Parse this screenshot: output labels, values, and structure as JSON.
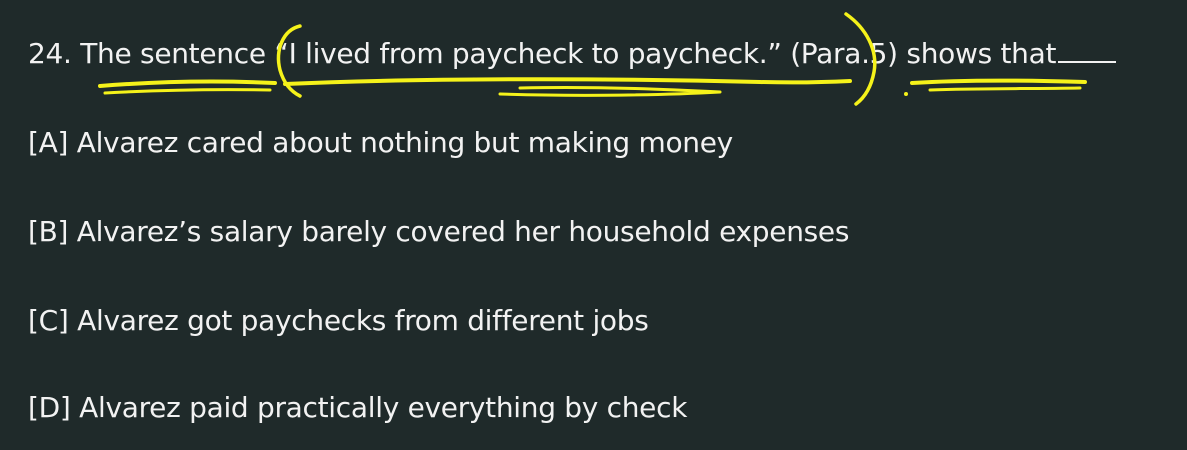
{
  "question": {
    "number": "24.",
    "text": "The sentence “I lived from paycheck to paycheck.” (Para.5) shows that"
  },
  "options": [
    {
      "letter": "[A]",
      "text": "Alvarez cared about nothing but making money"
    },
    {
      "letter": "[B]",
      "text": "Alvarez’s salary barely covered her household expenses"
    },
    {
      "letter": "[C]",
      "text": "Alvarez got paychecks from different jobs"
    },
    {
      "letter": "[D]",
      "text": "Alvarez paid practically everything by check"
    }
  ],
  "colors": {
    "background": "#1f2a2a",
    "text": "#f2f2f2",
    "highlighter": "#f5f21a"
  }
}
